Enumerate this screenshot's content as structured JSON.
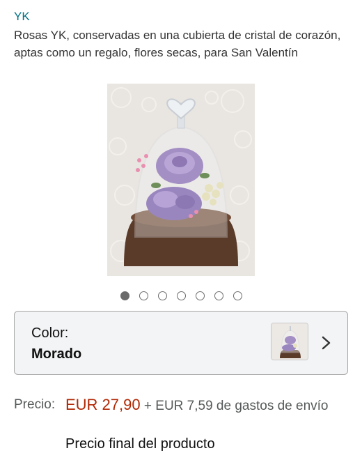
{
  "product": {
    "brand": "YK",
    "title": "Rosas YK, conservadas en una cubierta de cristal de corazón, aptas como un regalo, flores secas, para San Valentín"
  },
  "image_carousel": {
    "dot_count": 7,
    "active_index": 0
  },
  "variant": {
    "label": "Color:",
    "value": "Morado"
  },
  "price": {
    "label": "Precio:",
    "amount": "EUR 27,90",
    "shipping": " + EUR 7,59 de gastos de envío",
    "final_label": "Precio final del producto"
  },
  "colors": {
    "link": "#007185",
    "price": "#B12704",
    "box_bg": "#f3f4f5"
  }
}
